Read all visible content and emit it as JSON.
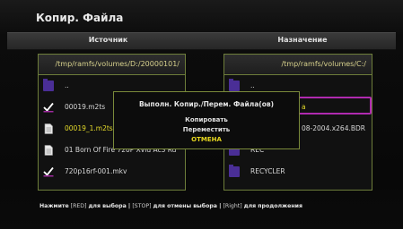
{
  "app": {
    "title": "Копир. Файла"
  },
  "header": {
    "source_label": "Источник",
    "dest_label": "Назначение"
  },
  "left_panel": {
    "path": "/tmp/ramfs/volumes/D:/20000101/",
    "items": [
      {
        "icon": "folder-icon",
        "label": ".."
      },
      {
        "icon": "checkbox-checked-icon",
        "label": "00019.m2ts"
      },
      {
        "icon": "file-icon",
        "label": "00019_1.m2ts"
      },
      {
        "icon": "file-icon",
        "label": "01 Born Of Fire 720P Xvid Ac3 Ru"
      },
      {
        "icon": "checkbox-checked-icon",
        "label": "720p16rf-001.mkv"
      }
    ]
  },
  "right_panel": {
    "path": "/tmp/ramfs/volumes/C:/",
    "items": [
      {
        "icon": "folder-icon",
        "label": ".."
      },
      {
        "icon": "folder-icon",
        "label": "a"
      },
      {
        "icon": "folder-icon",
        "label": "08-2004.x264.BDR"
      },
      {
        "icon": "folder-icon",
        "label": "REC"
      },
      {
        "icon": "folder-icon",
        "label": "RECYCLER"
      }
    ]
  },
  "dialog": {
    "title": "Выполн. Копир./Перем. Файла(ов)",
    "options": [
      "Копировать",
      "Переместить",
      "ОТМЕНА"
    ]
  },
  "footer": {
    "p1": "Нажмите",
    "k1": "[RED]",
    "p2": "для выбора | ",
    "k2": "[STOP]",
    "p3": "для отмены выбора | ",
    "k3": "[Right]",
    "p4": "для продолжения"
  },
  "colors": {
    "accent": "#e6dc2a",
    "border": "#6d7d3a",
    "selection": "#b02ab0",
    "folder": "#4a2e96"
  }
}
